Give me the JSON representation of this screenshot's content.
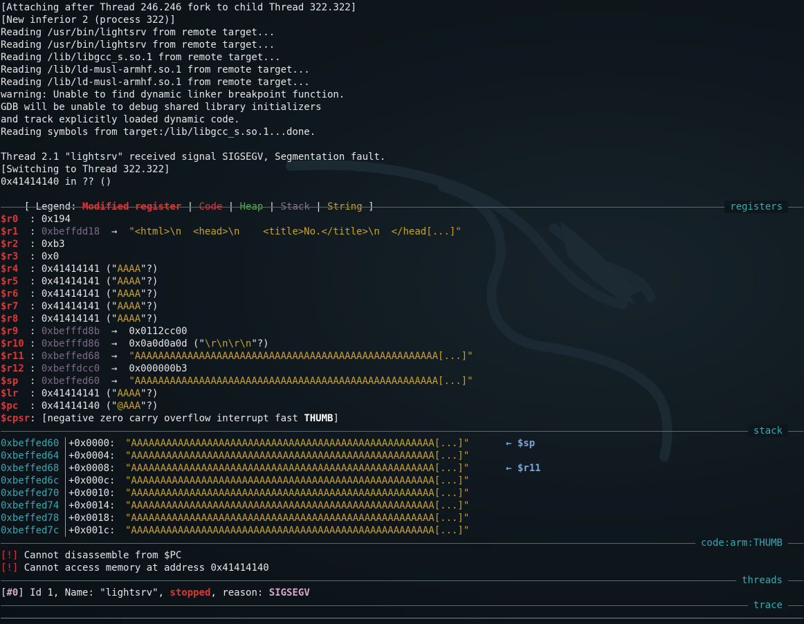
{
  "intro_lines": [
    "[Attaching after Thread 246.246 fork to child Thread 322.322]",
    "[New inferior 2 (process 322)]",
    "Reading /usr/bin/lightsrv from remote target...",
    "Reading /usr/bin/lightsrv from remote target...",
    "Reading /lib/libgcc_s.so.1 from remote target...",
    "Reading /lib/ld-musl-armhf.so.1 from remote target...",
    "Reading /lib/ld-musl-armhf.so.1 from remote target...",
    "warning: Unable to find dynamic linker breakpoint function.",
    "GDB will be unable to debug shared library initializers",
    "and track explicitly loaded dynamic code.",
    "Reading symbols from target:/lib/libgcc_s.so.1...done.",
    "",
    "Thread 2.1 \"lightsrv\" received signal SIGSEGV, Segmentation fault.",
    "[Switching to Thread 322.322]",
    "0x41414140 in ?? ()"
  ],
  "legend": {
    "open": "[ Legend: ",
    "modified": "Modified register",
    "sep": " | ",
    "code": "Code",
    "heap": "Heap",
    "stack": "Stack",
    "string": "String",
    "close": " ]"
  },
  "sections": {
    "registers": "registers",
    "stack": "stack",
    "code": "code:arm:THUMB",
    "threads": "threads",
    "trace": "trace"
  },
  "registers": [
    {
      "name": "$r0",
      "value": "0x194"
    },
    {
      "name": "$r1",
      "ptr": "0xbeffdd18",
      "arrow": "→",
      "str": "\"<html>\\n  <head>\\n    <title>No.</title>\\n  </head[...]\""
    },
    {
      "name": "$r2",
      "value": "0xb3"
    },
    {
      "name": "$r3",
      "value": "0x0"
    },
    {
      "name": "$r4",
      "value": "0x41414141 (\"",
      "str": "AAAA",
      "tail": "\"?)"
    },
    {
      "name": "$r5",
      "value": "0x41414141 (\"",
      "str": "AAAA",
      "tail": "\"?)"
    },
    {
      "name": "$r6",
      "value": "0x41414141 (\"",
      "str": "AAAA",
      "tail": "\"?)"
    },
    {
      "name": "$r7",
      "value": "0x41414141 (\"",
      "str": "AAAA",
      "tail": "\"?)"
    },
    {
      "name": "$r8",
      "value": "0x41414141 (\"",
      "str": "AAAA",
      "tail": "\"?)"
    },
    {
      "name": "$r9",
      "ptr": "0xbefffd8b",
      "arrow": "→",
      "value": "0x0112cc00"
    },
    {
      "name": "$r10",
      "ptr": "0xbefffd86",
      "arrow": "→",
      "value": "0x0a0d0a0d (\"",
      "str": "\\r\\n\\r\\n",
      "tail": "\"?)"
    },
    {
      "name": "$r11",
      "ptr": "0xbeffed68",
      "arrow": "→",
      "str": "\"AAAAAAAAAAAAAAAAAAAAAAAAAAAAAAAAAAAAAAAAAAAAAAAAAAAA[...]\""
    },
    {
      "name": "$r12",
      "ptr": "0xbeffdcc0",
      "arrow": "→",
      "value": "0x000000b3"
    },
    {
      "name": "$sp",
      "ptr": "0xbeffed60",
      "arrow": "→",
      "str": "\"AAAAAAAAAAAAAAAAAAAAAAAAAAAAAAAAAAAAAAAAAAAAAAAAAAAA[...]\""
    },
    {
      "name": "$lr",
      "value": "0x41414141 (\"",
      "str": "AAAA",
      "tail": "\"?)"
    },
    {
      "name": "$pc",
      "value": "0x41414140 (\"",
      "str": "@AAA",
      "tail": "\"?)"
    }
  ],
  "cpsr": {
    "name": "$cpsr",
    "flags": "[negative zero carry overflow interrupt fast ",
    "mode": "THUMB",
    "close": "]"
  },
  "stack_rows": [
    {
      "addr": "0xbeffed60",
      "off": "+0x0000:",
      "str": "\"AAAAAAAAAAAAAAAAAAAAAAAAAAAAAAAAAAAAAAAAAAAAAAAAAAAA[...]\"",
      "anno": "← $sp"
    },
    {
      "addr": "0xbeffed64",
      "off": "+0x0004:",
      "str": "\"AAAAAAAAAAAAAAAAAAAAAAAAAAAAAAAAAAAAAAAAAAAAAAAAAAAA[...]\"",
      "anno": ""
    },
    {
      "addr": "0xbeffed68",
      "off": "+0x0008:",
      "str": "\"AAAAAAAAAAAAAAAAAAAAAAAAAAAAAAAAAAAAAAAAAAAAAAAAAAAA[...]\"",
      "anno": "← $r11"
    },
    {
      "addr": "0xbeffed6c",
      "off": "+0x000c:",
      "str": "\"AAAAAAAAAAAAAAAAAAAAAAAAAAAAAAAAAAAAAAAAAAAAAAAAAAAA[...]\"",
      "anno": ""
    },
    {
      "addr": "0xbeffed70",
      "off": "+0x0010:",
      "str": "\"AAAAAAAAAAAAAAAAAAAAAAAAAAAAAAAAAAAAAAAAAAAAAAAAAAAA[...]\"",
      "anno": ""
    },
    {
      "addr": "0xbeffed74",
      "off": "+0x0014:",
      "str": "\"AAAAAAAAAAAAAAAAAAAAAAAAAAAAAAAAAAAAAAAAAAAAAAAAAAAA[...]\"",
      "anno": ""
    },
    {
      "addr": "0xbeffed78",
      "off": "+0x0018:",
      "str": "\"AAAAAAAAAAAAAAAAAAAAAAAAAAAAAAAAAAAAAAAAAAAAAAAAAAAA[...]\"",
      "anno": ""
    },
    {
      "addr": "0xbeffed7c",
      "off": "+0x001c:",
      "str": "\"AAAAAAAAAAAAAAAAAAAAAAAAAAAAAAAAAAAAAAAAAAAAAAAAAAAA[...]\"",
      "anno": ""
    }
  ],
  "code_msgs": [
    {
      "tag": "[!]",
      "text": " Cannot disassemble from $PC"
    },
    {
      "tag": "[!]",
      "text": " Cannot access memory at address 0x41414140"
    }
  ],
  "thread": {
    "open": "[",
    "idx": "#0",
    "close": "]",
    "text1": " Id 1, Name: \"lightsrv\", ",
    "state": "stopped",
    "text2": ", reason: ",
    "reason": "SIGSEGV"
  }
}
